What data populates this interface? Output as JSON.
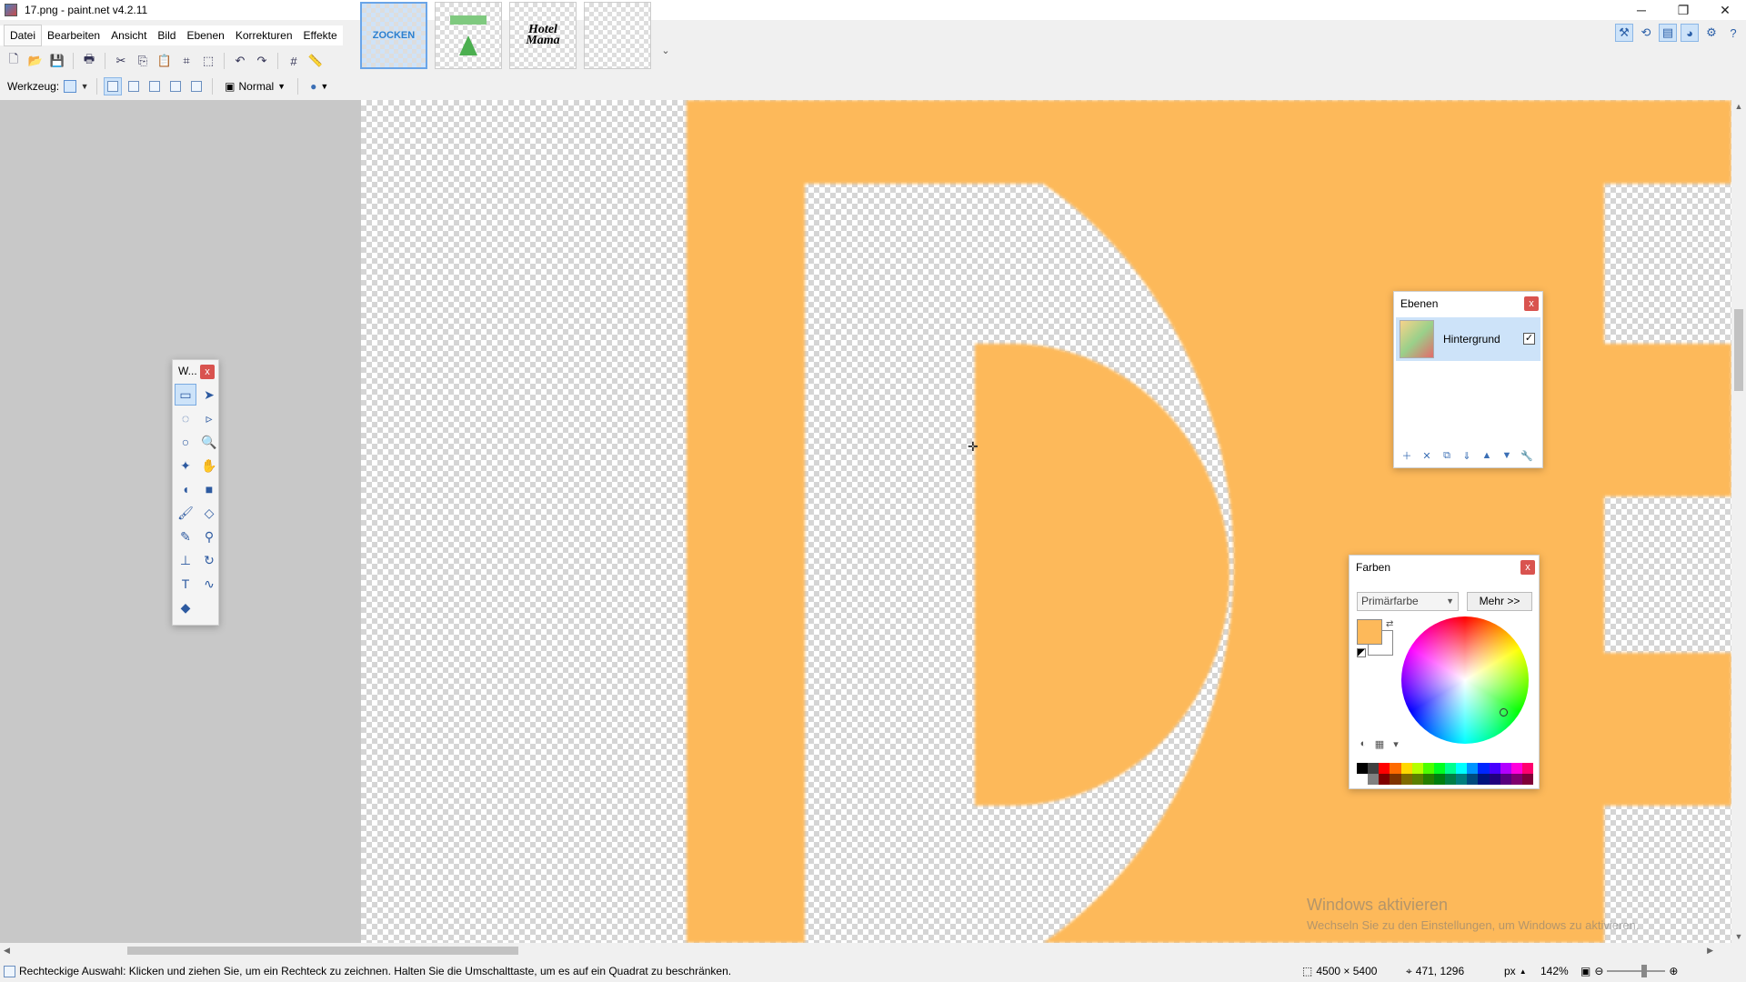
{
  "window": {
    "title": "17.png - paint.net v4.2.11",
    "controls": [
      "─",
      "❐",
      "✕"
    ]
  },
  "menu": [
    "Datei",
    "Bearbeiten",
    "Ansicht",
    "Bild",
    "Ebenen",
    "Korrekturen",
    "Effekte"
  ],
  "thumbnails": [
    {
      "text": "ZOCKEN",
      "active": true
    },
    {
      "text": "",
      "active": false
    },
    {
      "text": "Hotel Mama",
      "active": false
    },
    {
      "text": "",
      "active": false
    }
  ],
  "toolbar2": {
    "tool_label": "Werkzeug:",
    "blend_mode": "Normal"
  },
  "tools_panel": {
    "title": "W...",
    "close": "x"
  },
  "layers_panel": {
    "title": "Ebenen",
    "close": "x",
    "layers": [
      {
        "name": "Hintergrund",
        "visible": true
      }
    ]
  },
  "colors_panel": {
    "title": "Farben",
    "close": "x",
    "select_value": "Primärfarbe",
    "more_button": "Mehr >>",
    "primary_color": "#FDB95A",
    "secondary_color": "#FFFFFF"
  },
  "palette": [
    "#000000",
    "#404040",
    "#ff0000",
    "#ff6a00",
    "#ffd800",
    "#b6ff00",
    "#4cff00",
    "#00ff21",
    "#00ff90",
    "#00ffff",
    "#0094ff",
    "#0026ff",
    "#4800ff",
    "#b200ff",
    "#ff00dc",
    "#ff006e",
    "#ffffff",
    "#808080",
    "#7f0000",
    "#7f3300",
    "#7f6a00",
    "#5b7f00",
    "#267f00",
    "#007f0e",
    "#007f46",
    "#007f7f",
    "#004a7f",
    "#00137f",
    "#21007f",
    "#57007f",
    "#7f006e",
    "#7f0037"
  ],
  "status": {
    "hint": "Rechteckige Auswahl: Klicken und ziehen Sie, um ein Rechteck zu zeichnen. Halten Sie die Umschalttaste, um es auf ein Quadrat zu beschränken.",
    "image_size": "4500 × 5400",
    "cursor_pos": "471, 1296",
    "unit": "px",
    "zoom": "142%"
  },
  "watermark": {
    "line1": "Windows aktivieren",
    "line2": "Wechseln Sie zu den Einstellungen, um Windows zu aktivieren."
  },
  "colors": {
    "accent": "#cde3f9",
    "letter": "#FDB95A"
  }
}
